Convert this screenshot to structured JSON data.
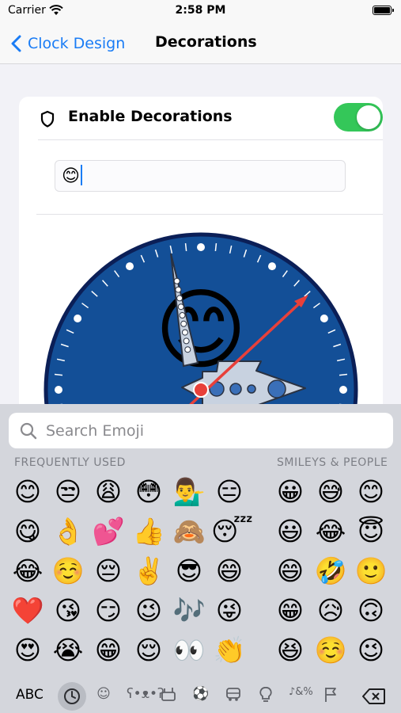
{
  "status": {
    "carrier": "Carrier",
    "time": "2:58 PM"
  },
  "nav": {
    "back_label": "Clock Design",
    "title": "Decorations"
  },
  "decorations": {
    "toggle_label": "Enable Decorations",
    "enabled": true,
    "input_value": "😊"
  },
  "clock": {
    "center_emoji": "😊",
    "hand_bead_count": 9
  },
  "colors": {
    "accent": "#1a7cf5",
    "toggle_on": "#34c759",
    "clock_face": "#134f97",
    "second_hand": "#e8403a"
  },
  "keyboard": {
    "search_placeholder": "Search Emoji",
    "frequently_used_label": "FREQUENTLY USED",
    "smileys_label": "SMILEYS & PEOPLE",
    "frequent_columns": [
      [
        "😊",
        "😋",
        "😂",
        "❤️",
        "😍"
      ],
      [
        "😒",
        "👌",
        "☺️",
        "😘",
        "😭"
      ],
      [
        "😩",
        "💕",
        "😔",
        "😏",
        "😁"
      ],
      [
        "😳",
        "👍",
        "✌️",
        "😉",
        "😌"
      ],
      [
        "💁‍♂️",
        "🙈",
        "😎",
        "🎶",
        "👀"
      ],
      [
        "😑",
        "😴",
        "😄",
        "😜",
        "👏"
      ]
    ],
    "smileys_columns": [
      [
        "😀",
        "😃",
        "😄",
        "😁",
        "😆"
      ],
      [
        "😅",
        "😂",
        "🤣",
        "😥",
        "☺️"
      ],
      [
        "😊",
        "😇",
        "🙂",
        "🙃",
        "😉"
      ]
    ],
    "abc_label": "ABC",
    "categories": [
      "recents-icon",
      "smileys-icon",
      "animals-icon",
      "food-icon",
      "activity-icon",
      "travel-icon",
      "objects-icon",
      "symbols-icon",
      "flags-icon"
    ]
  }
}
